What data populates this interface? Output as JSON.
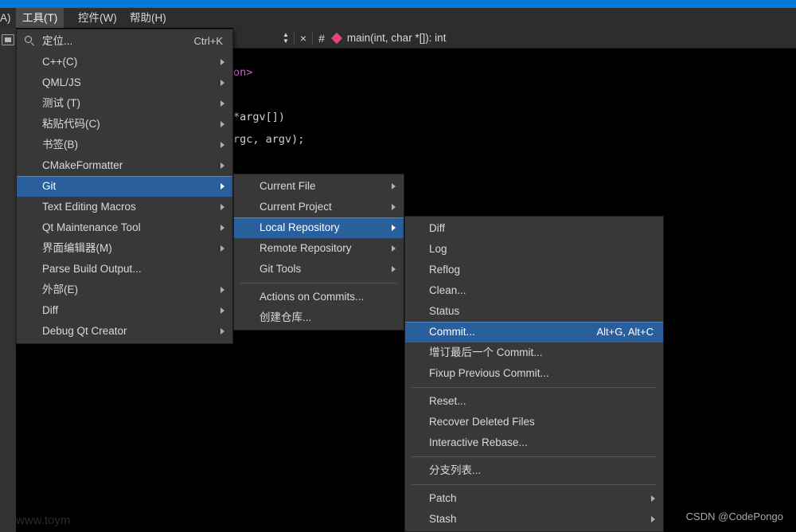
{
  "titlebar": {
    "accent_color": "#0078d7"
  },
  "menubar": {
    "partial_left": "A)",
    "items": [
      {
        "label": "工具(T)",
        "mnemonic": "T",
        "active": true
      },
      {
        "label": "控件(W)",
        "mnemonic": "W",
        "active": false
      },
      {
        "label": "帮助(H)",
        "mnemonic": "H",
        "active": false
      }
    ]
  },
  "editor_toolbar": {
    "updown_icon": "updown-arrows-icon",
    "close_icon": "×",
    "hash_icon": "#",
    "symbol_icon": "function-symbol-icon",
    "symbol_text": "main(int, char *[]): int"
  },
  "editor": {
    "line1": "on>",
    "line2": "*argv[])",
    "line3": "rgc, argv);",
    "background": "#000000"
  },
  "tools_menu": {
    "items": [
      {
        "label": "定位...",
        "shortcut": "Ctrl+K",
        "icon": "search-icon",
        "arrow": false,
        "selected": false
      },
      {
        "label": "C++(C)",
        "shortcut": "",
        "arrow": true,
        "selected": false
      },
      {
        "label": "QML/JS",
        "shortcut": "",
        "arrow": true,
        "selected": false
      },
      {
        "label": "测试 (T)",
        "shortcut": "",
        "arrow": true,
        "selected": false
      },
      {
        "label": "粘贴代码(C)",
        "shortcut": "",
        "arrow": true,
        "selected": false
      },
      {
        "label": "书签(B)",
        "shortcut": "",
        "arrow": true,
        "selected": false
      },
      {
        "label": "CMakeFormatter",
        "shortcut": "",
        "arrow": true,
        "selected": false
      },
      {
        "label": "Git",
        "shortcut": "",
        "arrow": true,
        "selected": true
      },
      {
        "label": "Text Editing Macros",
        "shortcut": "",
        "arrow": true,
        "selected": false
      },
      {
        "label": "Qt Maintenance Tool",
        "shortcut": "",
        "arrow": true,
        "selected": false
      },
      {
        "label": "界面编辑器(M)",
        "shortcut": "",
        "arrow": true,
        "selected": false
      },
      {
        "label": "Parse Build Output...",
        "shortcut": "",
        "arrow": false,
        "selected": false
      },
      {
        "label": "外部(E)",
        "shortcut": "",
        "arrow": true,
        "selected": false
      },
      {
        "label": "Diff",
        "shortcut": "",
        "arrow": true,
        "selected": false
      },
      {
        "label": "Debug Qt Creator",
        "shortcut": "",
        "arrow": true,
        "selected": false
      }
    ]
  },
  "git_menu": {
    "items": [
      {
        "label": "Current File",
        "arrow": true,
        "selected": false,
        "separator_after": false
      },
      {
        "label": "Current Project",
        "arrow": true,
        "selected": false,
        "separator_after": false
      },
      {
        "label": "Local Repository",
        "arrow": true,
        "selected": true,
        "separator_after": false
      },
      {
        "label": "Remote Repository",
        "arrow": true,
        "selected": false,
        "separator_after": false
      },
      {
        "label": "Git Tools",
        "arrow": true,
        "selected": false,
        "separator_after": true
      },
      {
        "label": "Actions on Commits...",
        "arrow": false,
        "selected": false,
        "separator_after": false
      },
      {
        "label": "创建仓库...",
        "arrow": false,
        "selected": false,
        "separator_after": false
      }
    ]
  },
  "local_repository_menu": {
    "items": [
      {
        "label": "Diff",
        "shortcut": "",
        "arrow": false,
        "selected": false,
        "separator_after": false
      },
      {
        "label": "Log",
        "shortcut": "",
        "arrow": false,
        "selected": false,
        "separator_after": false
      },
      {
        "label": "Reflog",
        "shortcut": "",
        "arrow": false,
        "selected": false,
        "separator_after": false
      },
      {
        "label": "Clean...",
        "shortcut": "",
        "arrow": false,
        "selected": false,
        "separator_after": false
      },
      {
        "label": "Status",
        "shortcut": "",
        "arrow": false,
        "selected": false,
        "separator_after": false
      },
      {
        "label": "Commit...",
        "shortcut": "Alt+G, Alt+C",
        "arrow": false,
        "selected": true,
        "separator_after": false
      },
      {
        "label": "增订最后一个 Commit...",
        "shortcut": "",
        "arrow": false,
        "selected": false,
        "separator_after": false
      },
      {
        "label": "Fixup Previous Commit...",
        "shortcut": "",
        "arrow": false,
        "selected": false,
        "separator_after": true
      },
      {
        "label": "Reset...",
        "shortcut": "",
        "arrow": false,
        "selected": false,
        "separator_after": false
      },
      {
        "label": "Recover Deleted Files",
        "shortcut": "",
        "arrow": false,
        "selected": false,
        "separator_after": false
      },
      {
        "label": "Interactive Rebase...",
        "shortcut": "",
        "arrow": false,
        "selected": false,
        "separator_after": true
      },
      {
        "label": "分支列表...",
        "shortcut": "",
        "arrow": false,
        "selected": false,
        "separator_after": true
      },
      {
        "label": "Patch",
        "shortcut": "",
        "arrow": true,
        "selected": false,
        "separator_after": false
      },
      {
        "label": "Stash",
        "shortcut": "",
        "arrow": true,
        "selected": false,
        "separator_after": false
      }
    ]
  },
  "watermarks": {
    "csdn": "CSDN @CodePongo",
    "site": "www.toym"
  },
  "colors": {
    "menu_bg": "#383838",
    "highlight": "#2a5f9e",
    "text": "#d9d9d9",
    "accent_blue": "#0078d7",
    "symbol_pink": "#e0457b"
  }
}
